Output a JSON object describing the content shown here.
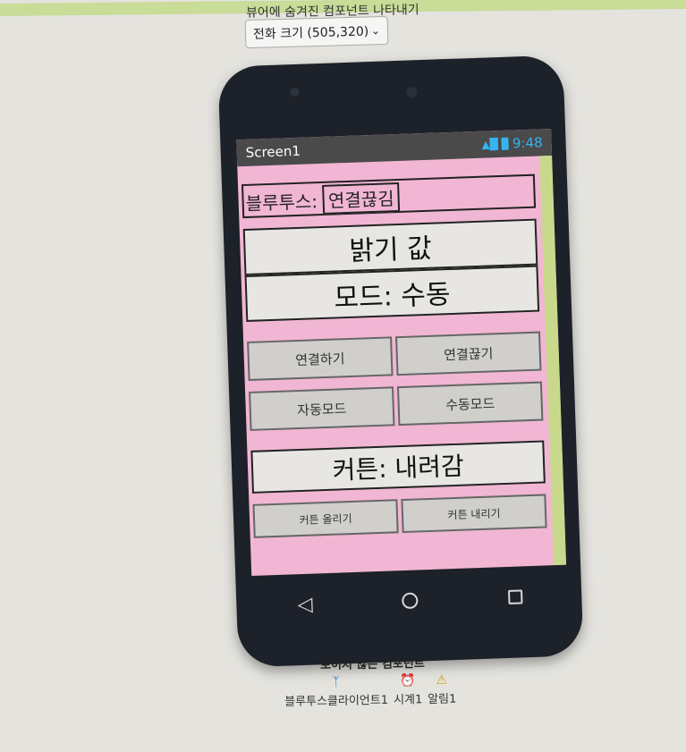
{
  "header": {
    "checkbox_label": "뷰어에 숨겨진 컴포넌트 나타내기",
    "size_select_value": "전화 크기 (505,320)"
  },
  "phone": {
    "screen_title": "Screen1",
    "status_time": "9:48"
  },
  "app": {
    "bluetooth_label": "블루투스:",
    "bluetooth_status": "연결끊김",
    "brightness_label": "밝기 값",
    "mode_label": "모드: 수동",
    "connect_button": "연결하기",
    "disconnect_button": "연결끊기",
    "auto_mode_button": "자동모드",
    "manual_mode_button": "수동모드",
    "curtain_label": "커튼: 내려감",
    "curtain_up_button": "커튼 올리기",
    "curtain_down_button": "커튼 내리기"
  },
  "invisible_components": {
    "title": "보이지 않는 컴포넌트",
    "items": [
      "블루투스클라이언트1",
      "시계1",
      "알림1"
    ],
    "icons": [
      "bluetooth-icon",
      "clock-icon",
      "warning-icon"
    ]
  },
  "colors": {
    "screen_background": "#f1b6d3",
    "side_bar": "#c9d98b",
    "status_accent": "#35b4f0"
  }
}
